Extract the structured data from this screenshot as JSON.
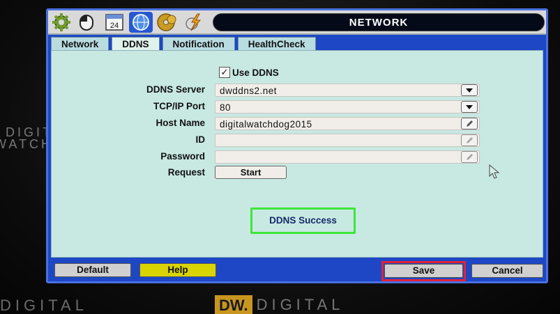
{
  "window": {
    "title": "NETWORK",
    "toolbar_icons": [
      "gear-icon",
      "mouse-icon",
      "calendar-icon",
      "globe-icon",
      "disc-icon",
      "lightning-icon"
    ],
    "calendar_number": "24"
  },
  "tabs": [
    {
      "label": "Network",
      "active": false
    },
    {
      "label": "DDNS",
      "active": true
    },
    {
      "label": "Notification",
      "active": false
    },
    {
      "label": "HealthCheck",
      "active": false
    }
  ],
  "ddns": {
    "use_ddns_label": "Use DDNS",
    "use_ddns_checked": true,
    "check_mark": "✓",
    "server_label": "DDNS Server",
    "server_value": "dwddns2.net",
    "port_label": "TCP/IP Port",
    "port_value": "80",
    "host_label": "Host Name",
    "host_value": "digitalwatchdog2015",
    "id_label": "ID",
    "id_value": "",
    "password_label": "Password",
    "password_value": "",
    "request_label": "Request",
    "start_label": "Start",
    "status_text": "DDNS Success"
  },
  "footer": {
    "default_label": "Default",
    "help_label": "Help",
    "save_label": "Save",
    "cancel_label": "Cancel"
  },
  "background": {
    "left_logo_top": "DIGIT",
    "left_logo_bottom": "WATCHD",
    "bottom_logo_a": "DIGITAL",
    "bottom_logo_mark": "DW.",
    "bottom_logo_b": "DIGITAL"
  },
  "colors": {
    "window_blue": "#1d47c5",
    "panel": "#c8e8e2",
    "success_border": "#3ee63a",
    "save_highlight": "#e0223a",
    "help_yellow": "#d9d400"
  }
}
